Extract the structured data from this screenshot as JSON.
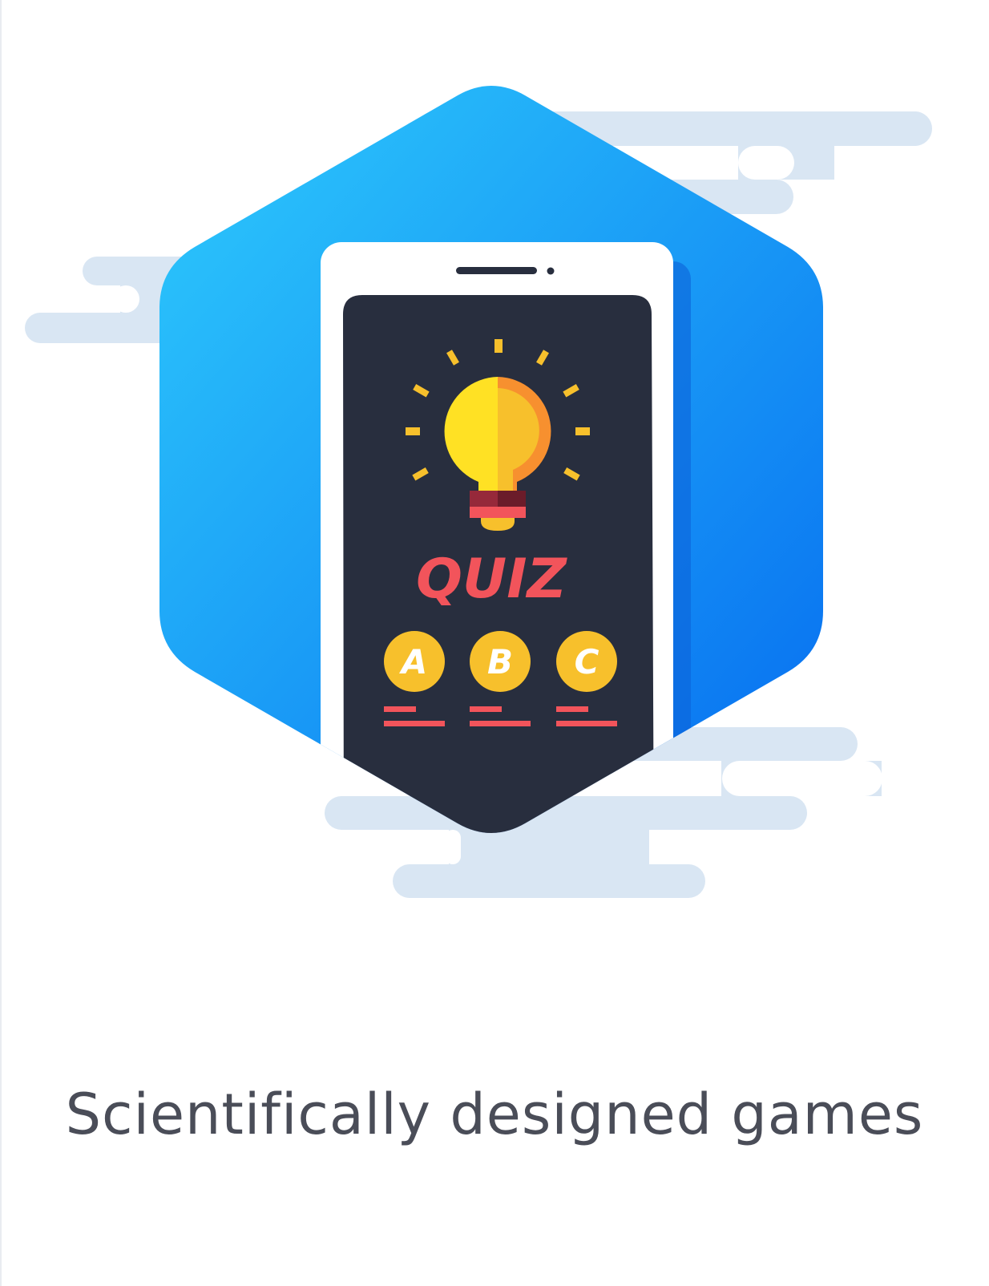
{
  "illustration": {
    "quiz_label": "QUIZ",
    "options": [
      "A",
      "B",
      "C"
    ],
    "colors": {
      "hexagon_top": "#29C6FB",
      "hexagon_bottom": "#0870F0",
      "cloud": "#D9E6F3",
      "phone_body": "#FFFFFF",
      "phone_screen": "#282E3E",
      "bulb_yellow": "#FFE124",
      "bulb_orange": "#F7902F",
      "bulb_base": "#96293A",
      "ray": "#F7C02C",
      "quiz_text": "#F2545B",
      "option_circle": "#F7C02C",
      "option_line": "#F2545B"
    },
    "icon": "lightbulb-icon"
  },
  "caption": {
    "text": "Scientifically designed games"
  }
}
